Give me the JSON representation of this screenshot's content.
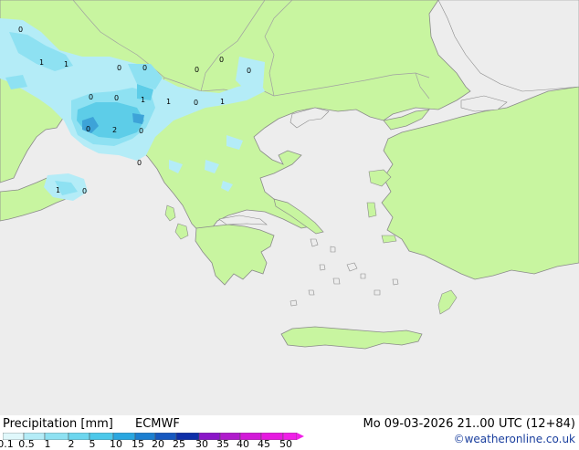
{
  "map": {
    "colors": {
      "sea": "#ededed",
      "land": "#c8f5a0",
      "coast": "#8a8a8a",
      "border": "#a0a0a0",
      "precip_light": "#b4ecf7",
      "precip_mid": "#8ee1f2",
      "precip_heavy": "#5dcde8",
      "precip_core": "#3da3d8"
    },
    "precip_values": [
      "0",
      "1",
      "1",
      "0",
      "0",
      "0",
      "0",
      "0",
      "0",
      "0",
      "1",
      "1",
      "0",
      "1",
      "2",
      "0",
      "0",
      "0",
      "1",
      "0"
    ]
  },
  "footer": {
    "legend_title": "Precipitation [mm]",
    "model": "ECMWF",
    "valid_time": "Mo 09-03-2026 21..00 UTC (12+84)",
    "credit": "©weatheronline.co.uk"
  },
  "colorbar": {
    "labels": [
      "0.1",
      "0.5",
      "1",
      "2",
      "5",
      "10",
      "15",
      "20",
      "25",
      "30",
      "35",
      "40",
      "45",
      "50"
    ],
    "colors": [
      "#e0f8fb",
      "#b4ecf7",
      "#8ee1f2",
      "#6dd6ee",
      "#4cc8ea",
      "#2aa7e0",
      "#1c7fd0",
      "#1658bf",
      "#0e2fa8",
      "#8a16c8",
      "#b01ccc",
      "#d21ad8",
      "#e61ae0",
      "#f020e8"
    ]
  }
}
